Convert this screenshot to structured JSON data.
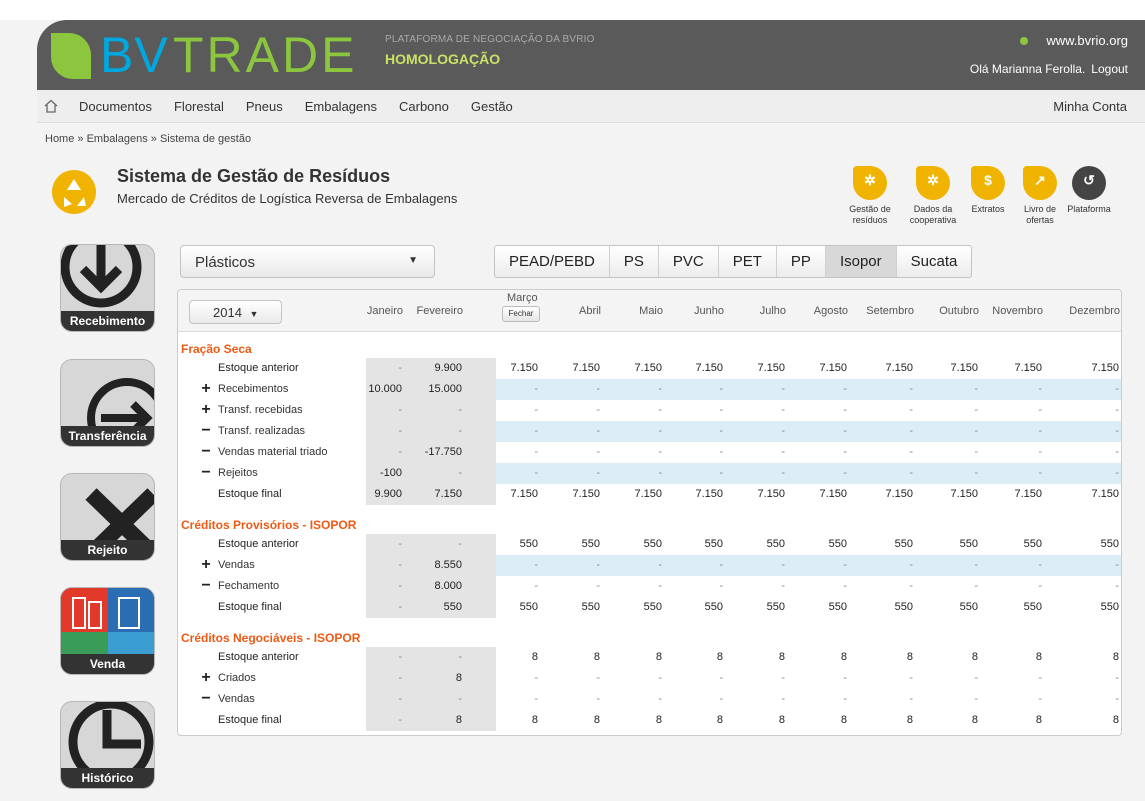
{
  "header": {
    "logo_bv": "BV",
    "logo_trade": "TRADE",
    "tagline": "PLATAFORMA DE NEGOCIAÇÃO DA BVRIO",
    "environment": "HOMOLOGAÇÃO",
    "site": "www.bvrio.org",
    "greeting": "Olá Marianna Ferolla.",
    "logout": "Logout"
  },
  "nav": {
    "items": [
      "Documentos",
      "Florestal",
      "Pneus",
      "Embalagens",
      "Carbono",
      "Gestão"
    ],
    "account": "Minha Conta"
  },
  "breadcrumb": "Home » Embalagens » Sistema de gestão",
  "page": {
    "title": "Sistema de Gestão de Resíduos",
    "subtitle": "Mercado de Créditos de Logística Reversa de Embalagens"
  },
  "tools": [
    {
      "label": "Gestão de resíduos",
      "icon": "gear-icon"
    },
    {
      "label": "Dados da cooperativa",
      "icon": "gear-icon"
    },
    {
      "label": "Extratos",
      "icon": "document-icon"
    },
    {
      "label": "Livro de ofertas",
      "icon": "chart-icon"
    },
    {
      "label": "Plataforma",
      "icon": "back-arrow-icon"
    }
  ],
  "side_tiles": [
    "Recebimento",
    "Transferência",
    "Rejeito",
    "Venda",
    "Histórico"
  ],
  "category_select": "Plásticos",
  "material_tabs": [
    "PEAD/PEBD",
    "PS",
    "PVC",
    "PET",
    "PP",
    "Isopor",
    "Sucata"
  ],
  "active_tab": "Isopor",
  "year": "2014",
  "months": [
    "Janeiro",
    "Fevereiro",
    "Março",
    "Abril",
    "Maio",
    "Junho",
    "Julho",
    "Agosto",
    "Setembro",
    "Outubro",
    "Novembro",
    "Dezembro"
  ],
  "close_button": "Fechar",
  "sections": [
    {
      "title": "Fração Seca",
      "rows": [
        {
          "sign": "",
          "label": "Estoque anterior",
          "values": [
            "-",
            "9.900",
            "7.150",
            "7.150",
            "7.150",
            "7.150",
            "7.150",
            "7.150",
            "7.150",
            "7.150",
            "7.150",
            "7.150"
          ]
        },
        {
          "sign": "+",
          "label": "Recebimentos",
          "values": [
            "10.000",
            "15.000",
            "-",
            "-",
            "-",
            "-",
            "-",
            "-",
            "-",
            "-",
            "-",
            "-"
          ]
        },
        {
          "sign": "+",
          "label": "Transf. recebidas",
          "values": [
            "-",
            "-",
            "-",
            "-",
            "-",
            "-",
            "-",
            "-",
            "-",
            "-",
            "-",
            "-"
          ]
        },
        {
          "sign": "−",
          "label": "Transf. realizadas",
          "values": [
            "-",
            "-",
            "-",
            "-",
            "-",
            "-",
            "-",
            "-",
            "-",
            "-",
            "-",
            "-"
          ]
        },
        {
          "sign": "−",
          "label": "Vendas material triado",
          "values": [
            "-",
            "-17.750",
            "-",
            "-",
            "-",
            "-",
            "-",
            "-",
            "-",
            "-",
            "-",
            "-"
          ]
        },
        {
          "sign": "−",
          "label": "Rejeitos",
          "values": [
            "-100",
            "-",
            "-",
            "-",
            "-",
            "-",
            "-",
            "-",
            "-",
            "-",
            "-",
            "-"
          ]
        },
        {
          "sign": "",
          "label": "Estoque final",
          "values": [
            "9.900",
            "7.150",
            "7.150",
            "7.150",
            "7.150",
            "7.150",
            "7.150",
            "7.150",
            "7.150",
            "7.150",
            "7.150",
            "7.150"
          ]
        }
      ]
    },
    {
      "title": "Créditos Provisórios - ISOPOR",
      "rows": [
        {
          "sign": "",
          "label": "Estoque anterior",
          "values": [
            "-",
            "-",
            "550",
            "550",
            "550",
            "550",
            "550",
            "550",
            "550",
            "550",
            "550",
            "550"
          ]
        },
        {
          "sign": "+",
          "label": "Vendas",
          "values": [
            "-",
            "8.550",
            "-",
            "-",
            "-",
            "-",
            "-",
            "-",
            "-",
            "-",
            "-",
            "-"
          ]
        },
        {
          "sign": "−",
          "label": "Fechamento",
          "values": [
            "-",
            "8.000",
            "-",
            "-",
            "-",
            "-",
            "-",
            "-",
            "-",
            "-",
            "-",
            "-"
          ]
        },
        {
          "sign": "",
          "label": "Estoque final",
          "values": [
            "-",
            "550",
            "550",
            "550",
            "550",
            "550",
            "550",
            "550",
            "550",
            "550",
            "550",
            "550"
          ]
        }
      ]
    },
    {
      "title": "Créditos Negociáveis - ISOPOR",
      "rows": [
        {
          "sign": "",
          "label": "Estoque anterior",
          "values": [
            "-",
            "-",
            "8",
            "8",
            "8",
            "8",
            "8",
            "8",
            "8",
            "8",
            "8",
            "8"
          ]
        },
        {
          "sign": "+",
          "label": "Criados",
          "values": [
            "-",
            "8",
            "-",
            "-",
            "-",
            "-",
            "-",
            "-",
            "-",
            "-",
            "-",
            "-"
          ]
        },
        {
          "sign": "−",
          "label": "Vendas",
          "values": [
            "-",
            "-",
            "-",
            "-",
            "-",
            "-",
            "-",
            "-",
            "-",
            "-",
            "-",
            "-"
          ]
        },
        {
          "sign": "",
          "label": "Estoque final",
          "values": [
            "-",
            "8",
            "8",
            "8",
            "8",
            "8",
            "8",
            "8",
            "8",
            "8",
            "8",
            "8"
          ]
        }
      ]
    }
  ]
}
